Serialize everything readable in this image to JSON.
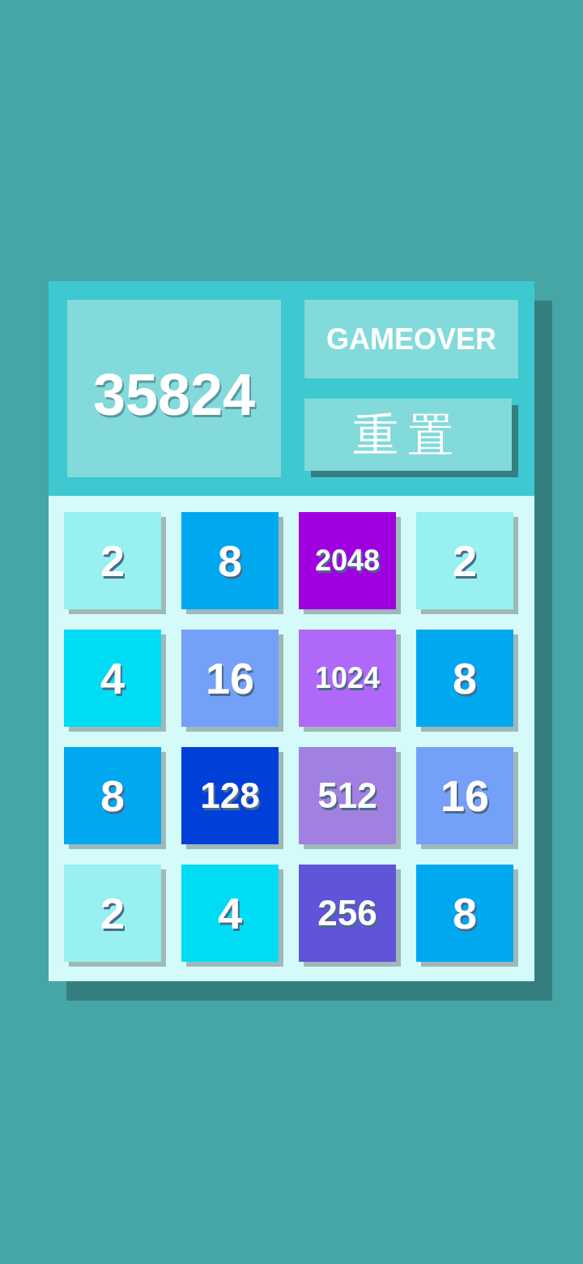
{
  "score": "35824",
  "status": "GAMEOVER",
  "reset_button": "重置",
  "board": [
    [
      {
        "value": "2",
        "color": "#98f0f0"
      },
      {
        "value": "8",
        "color": "#00a8f0"
      },
      {
        "value": "2048",
        "color": "#a000e0"
      },
      {
        "value": "2",
        "color": "#98f0f0"
      }
    ],
    [
      {
        "value": "4",
        "color": "#00dcf4"
      },
      {
        "value": "16",
        "color": "#74a0f8"
      },
      {
        "value": "1024",
        "color": "#b068f8"
      },
      {
        "value": "8",
        "color": "#00a8f0"
      }
    ],
    [
      {
        "value": "8",
        "color": "#00a8f0"
      },
      {
        "value": "128",
        "color": "#0040d8"
      },
      {
        "value": "512",
        "color": "#a080e0"
      },
      {
        "value": "16",
        "color": "#74a0f8"
      }
    ],
    [
      {
        "value": "2",
        "color": "#98f0f0"
      },
      {
        "value": "4",
        "color": "#00dcf4"
      },
      {
        "value": "256",
        "color": "#6054d8"
      },
      {
        "value": "8",
        "color": "#00a8f0"
      }
    ]
  ]
}
